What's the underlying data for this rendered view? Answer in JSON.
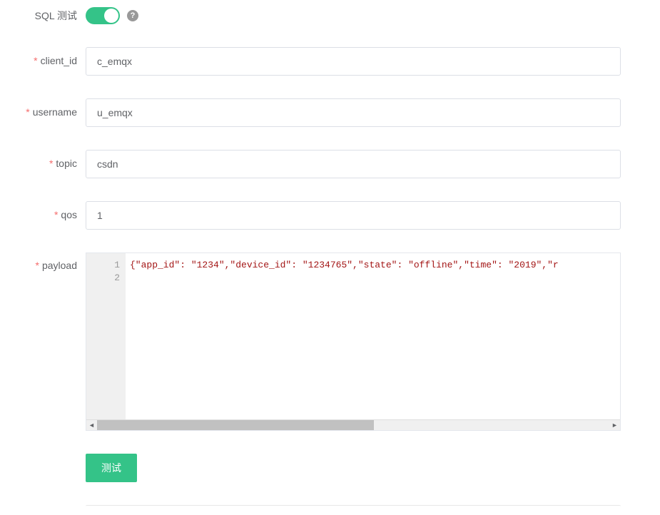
{
  "toggle": {
    "label": "SQL 测试",
    "on": true
  },
  "fields": {
    "client_id": {
      "label": "client_id",
      "value": "c_emqx"
    },
    "username": {
      "label": "username",
      "value": "u_emqx"
    },
    "topic": {
      "label": "topic",
      "value": "csdn"
    },
    "qos": {
      "label": "qos",
      "value": "1"
    },
    "payload": {
      "label": "payload"
    }
  },
  "payload_code": {
    "lines": [
      "1",
      "2"
    ],
    "content_display": "{\"app_id\": \"1234\",\"device_id\": \"1234765\",\"state\": \"offline\",\"time\": \"2019\",\"r"
  },
  "buttons": {
    "test": "测试"
  }
}
